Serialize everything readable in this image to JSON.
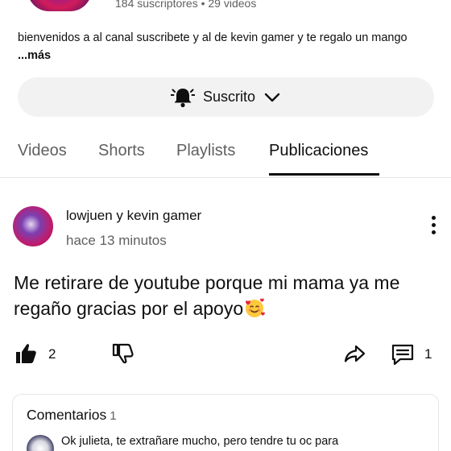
{
  "channel": {
    "stats": "184 suscriptores • 29 videos",
    "description": "bienvenidos a al canal suscribete y al de kevin  gamer y te regalo un mango",
    "more_label": "...más",
    "subscribe_label": "Suscrito"
  },
  "tabs": [
    {
      "label": "Videos",
      "active": false
    },
    {
      "label": "Shorts",
      "active": false
    },
    {
      "label": "Playlists",
      "active": false
    },
    {
      "label": "Publicaciones",
      "active": true
    }
  ],
  "post": {
    "author": "lowjuen y  kevin gamer",
    "time": "hace 13 minutos",
    "text": "Me retirare de youtube porque mi mama ya me regaño gracias por el apoyo",
    "emoji": "smiling-face-with-hearts-icon",
    "likes": "2",
    "comments_count": "1"
  },
  "comments": {
    "title": "Comentarios",
    "count": "1",
    "first_comment": "Ok julieta, te extrañare mucho, pero tendre tu oc para"
  },
  "colors": {
    "text_primary": "#0f0f0f",
    "text_secondary": "#606060",
    "button_bg": "#f2f2f2",
    "divider": "#e5e5e5"
  }
}
